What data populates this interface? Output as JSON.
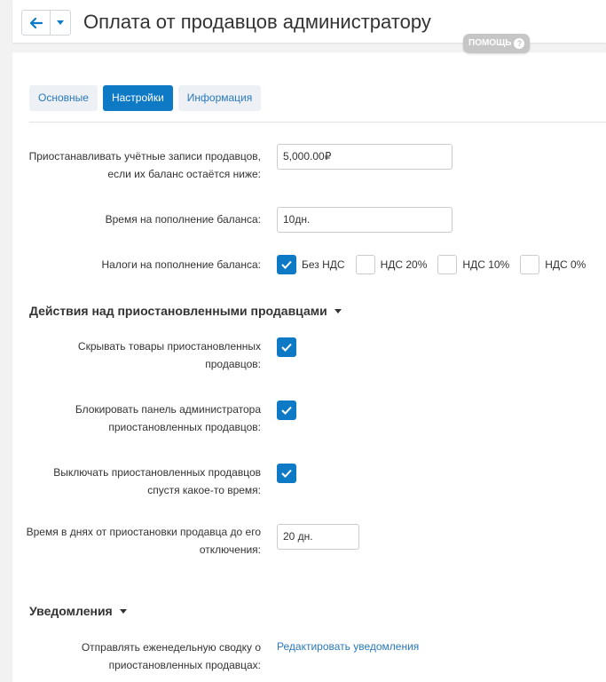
{
  "header": {
    "title": "Оплата от продавцов администратору",
    "help_label": "ПОМОЩЬ",
    "back_icon": "arrow-left-icon",
    "caret_icon": "chevron-down-icon"
  },
  "tabs": [
    {
      "label": "Основные",
      "active": false
    },
    {
      "label": "Настройки",
      "active": true
    },
    {
      "label": "Информация",
      "active": false
    }
  ],
  "settings": {
    "suspend": {
      "label_line1": "Приостанавливать учётные записи продавцов,",
      "label_line2": "если их баланс остаётся ниже:",
      "value": "5,000.00₽"
    },
    "topup_time": {
      "label": "Время на пополнение баланса:",
      "value": "10дн."
    },
    "taxes": {
      "label": "Налоги на пополнение баланса:",
      "options": [
        {
          "label": "Без НДС",
          "checked": true
        },
        {
          "label": "НДС 20%",
          "checked": false
        },
        {
          "label": "НДС 10%",
          "checked": false
        },
        {
          "label": "НДС 0%",
          "checked": false
        }
      ]
    }
  },
  "actions_section": {
    "title": "Действия над приостановленными продавцами",
    "hide_products": {
      "label_line1": "Скрывать товары приостановленных",
      "label_line2": "продавцов:",
      "checked": true
    },
    "block_panel": {
      "label_line1": "Блокировать панель администратора",
      "label_line2": "приостановленных продавцов:",
      "checked": true
    },
    "disable_after": {
      "label_line1": "Выключать приостановленных продавцов",
      "label_line2": "спустя какое-то время:",
      "checked": true
    },
    "days_until_disable": {
      "label_line1": "Время в днях от приостановки продавца до его",
      "label_line2": "отключения:",
      "value": "20 дн."
    }
  },
  "notifications_section": {
    "title": "Уведомления",
    "weekly_summary": {
      "label_line1": "Отправлять еженедельную сводку о",
      "label_line2": "приостановленных продавцах:",
      "link": "Редактировать уведомления"
    }
  },
  "colors": {
    "accent": "#0e7ac6",
    "link": "#2a79bd",
    "help_badge": "#c6c6c6"
  }
}
